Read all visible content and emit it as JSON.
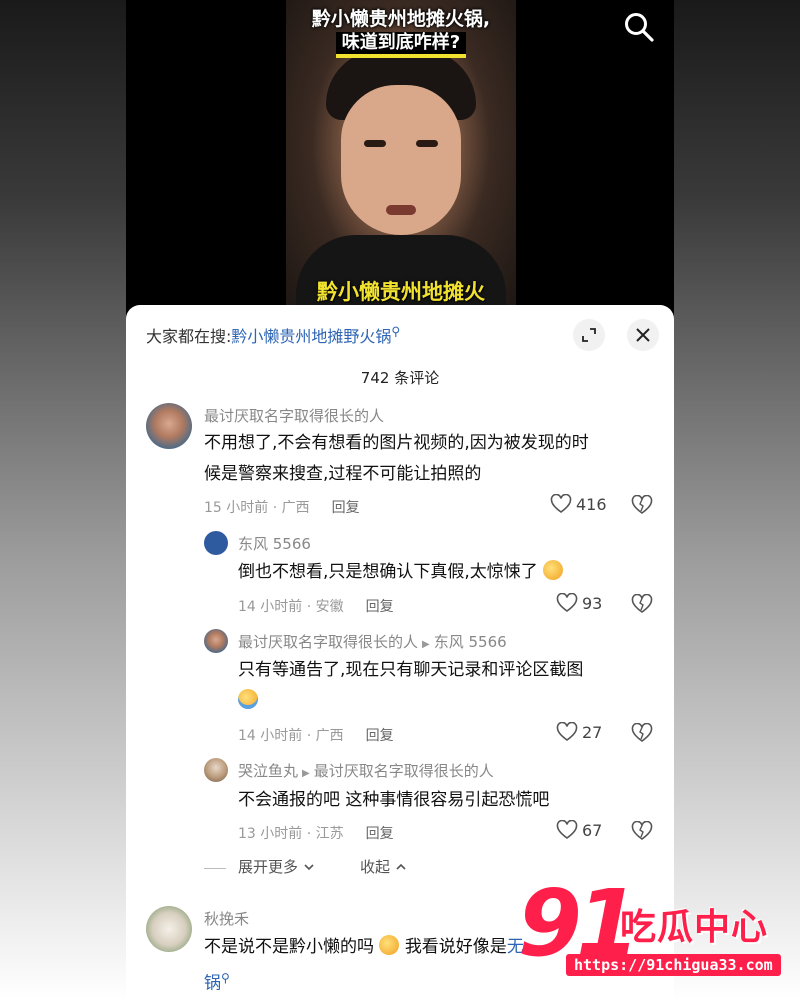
{
  "video": {
    "title_line1": "黔小懒贵州地摊火锅,",
    "title_line2": "味道到底咋样?",
    "caption": "黔小懒贵州地摊火"
  },
  "panel": {
    "search_prefix": "大家都在搜:",
    "search_keyword": "黔小懒贵州地摊野火锅",
    "comment_count": "742 条评论"
  },
  "comments": [
    {
      "user": "最讨厌取名字取得很长的人",
      "text_line1": "不用想了,不会有想看的图片视频的,因为被发现的时",
      "text_line2": "候是警察来搜查,过程不可能让拍照的",
      "meta": "15 小时前 · 广西",
      "reply": "回复",
      "likes": "416"
    },
    {
      "user": "东风 5566",
      "text": "倒也不想看,只是想确认下真假,太惊悚了",
      "meta": "14 小时前 · 安徽",
      "reply": "回复",
      "likes": "93"
    },
    {
      "user": "最讨厌取名字取得很长的人",
      "reply_to": "东风 5566",
      "text": "只有等通告了,现在只有聊天记录和评论区截图",
      "meta": "14 小时前 · 广西",
      "reply": "回复",
      "likes": "27"
    },
    {
      "user": "哭泣鱼丸",
      "reply_to": "最讨厌取名字取得很长的人",
      "text": "不会通报的吧 这种事情很容易引起恐慌吧",
      "meta": "13 小时前 · 江苏",
      "reply": "回复",
      "likes": "67"
    },
    {
      "user": "秋挽禾",
      "text_part1": "不是说不是黔小懒的吗",
      "text_part2": "我看说好像是",
      "text_link": "无",
      "text_line2": "锅"
    }
  ],
  "controls": {
    "expand": "展开更多",
    "collapse": "收起"
  },
  "watermark": {
    "number": "91",
    "name": "吃瓜中心",
    "url": "https://91chigua33.com"
  },
  "colors": {
    "accent_link": "#2d64b3",
    "watermark_red": "#ff1f4b",
    "caption_yellow": "#f2e230"
  }
}
